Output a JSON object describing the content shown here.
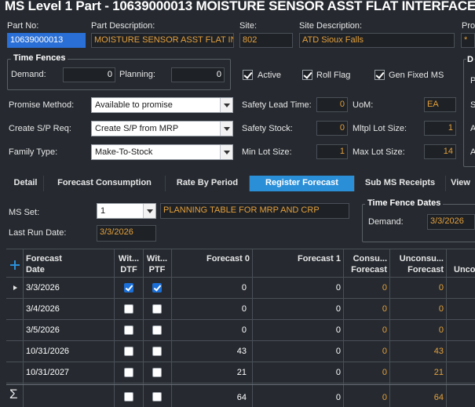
{
  "window": {
    "title": "MS Level 1 Part - 10639000013 MOISTURE SENSOR ASST FLAT INTERFACE"
  },
  "header": {
    "part_no_label": "Part No:",
    "part_no_value": "10639000013",
    "part_desc_label": "Part Description:",
    "part_desc_value": "MOISTURE SENSOR ASST FLAT INTE",
    "site_label": "Site:",
    "site_value": "802",
    "site_desc_label": "Site Description:",
    "site_desc_value": "ATD Sioux Falls",
    "pro_label": "Pro",
    "pro_value": "*"
  },
  "time_fences": {
    "title": "Time Fences",
    "demand_label": "Demand:",
    "demand_value": "0",
    "planning_label": "Planning:",
    "planning_value": "0"
  },
  "flags": {
    "active_label": "Active",
    "active_checked": true,
    "roll_flag_label": "Roll Flag",
    "roll_flag_checked": true,
    "gen_fixed_ms_label": "Gen Fixed MS",
    "gen_fixed_ms_checked": true
  },
  "settings": {
    "promise_method_label": "Promise Method:",
    "promise_method_value": "Available to promise",
    "create_sp_req_label": "Create S/P Req:",
    "create_sp_req_value": "Create S/P from MRP",
    "family_type_label": "Family Type:",
    "family_type_value": "Make-To-Stock",
    "safety_lead_time_label": "Safety Lead Time:",
    "safety_lead_time_value": "0",
    "safety_stock_label": "Safety Stock:",
    "safety_stock_value": "0",
    "min_lot_size_label": "Min Lot Size:",
    "min_lot_size_value": "1",
    "uom_label": "UoM:",
    "uom_value": "EA",
    "mltpl_lot_size_label": "Mltpl Lot Size:",
    "mltpl_lot_size_value": "1",
    "max_lot_size_label": "Max Lot Size:",
    "max_lot_size_value": "14"
  },
  "right_panel": {
    "title": "D",
    "labels": [
      "P",
      "S",
      "A",
      "A"
    ]
  },
  "tabs": [
    {
      "label": "Detail",
      "active": false
    },
    {
      "label": "Forecast Consumption",
      "active": false
    },
    {
      "label": "Rate By Period",
      "active": false
    },
    {
      "label": "Register Forecast",
      "active": true
    },
    {
      "label": "Sub MS Receipts",
      "active": false
    },
    {
      "label": "View",
      "active": false
    }
  ],
  "register": {
    "ms_set_label": "MS Set:",
    "ms_set_value": "1",
    "ms_set_desc": "PLANNING TABLE FOR MRP AND CRP",
    "last_run_label": "Last Run Date:",
    "last_run_value": "3/3/2026",
    "time_fence_dates_title": "Time Fence Dates",
    "tf_demand_label": "Demand:",
    "tf_demand_value": "3/3/2026"
  },
  "grid": {
    "add_icon": "plus-icon",
    "columns": {
      "forecast_date": [
        "Forecast",
        "Date"
      ],
      "within_dtf": [
        "Wit...",
        "DTF"
      ],
      "within_ptf": [
        "Wit...",
        "PTF"
      ],
      "forecast0": "Forecast 0",
      "forecast1": "Forecast 1",
      "consumed": [
        "Consu...",
        "Forecast"
      ],
      "unconsumed": [
        "Unconsu...",
        "Forecast"
      ],
      "unco": "Unco"
    },
    "rows": [
      {
        "date": "3/3/2026",
        "dtf": true,
        "ptf": true,
        "f0": "0",
        "f1": "0",
        "cons": "0",
        "uncons": "0",
        "current": true
      },
      {
        "date": "3/4/2026",
        "dtf": false,
        "ptf": false,
        "f0": "0",
        "f1": "0",
        "cons": "0",
        "uncons": "0",
        "current": false
      },
      {
        "date": "3/5/2026",
        "dtf": false,
        "ptf": false,
        "f0": "0",
        "f1": "0",
        "cons": "0",
        "uncons": "0",
        "current": false
      },
      {
        "date": "10/31/2026",
        "dtf": false,
        "ptf": false,
        "f0": "43",
        "f1": "0",
        "cons": "0",
        "uncons": "43",
        "current": false
      },
      {
        "date": "10/31/2027",
        "dtf": false,
        "ptf": false,
        "f0": "21",
        "f1": "0",
        "cons": "0",
        "uncons": "21",
        "current": false
      }
    ],
    "totals": {
      "symbol": "Σ",
      "f0": "64",
      "f1": "0",
      "cons": "0",
      "uncons": "64"
    }
  },
  "colors": {
    "background": "#262a30",
    "accent": "#2b8fd8",
    "value_orange": "#e5a13b"
  }
}
